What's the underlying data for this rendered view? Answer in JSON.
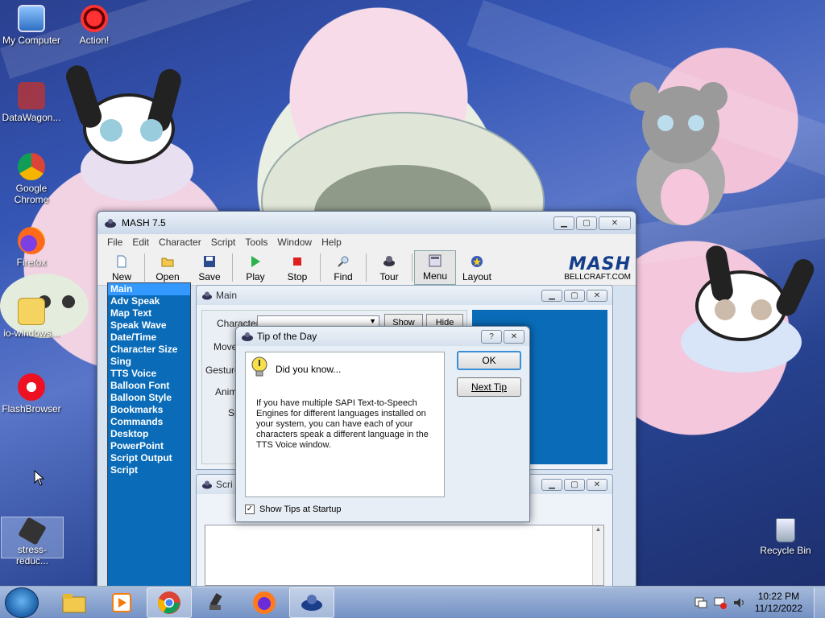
{
  "desktop": {
    "icons": [
      {
        "label": "My Computer"
      },
      {
        "label": "Action!"
      },
      {
        "label": "DataWagon..."
      },
      {
        "label": "Google Chrome"
      },
      {
        "label": "Firefox"
      },
      {
        "label": "io-windows..."
      },
      {
        "label": "FlashBrowser"
      },
      {
        "label": "stress-reduc..."
      },
      {
        "label": "Recycle Bin"
      }
    ]
  },
  "main_window": {
    "title": "MASH 7.5",
    "menu": [
      "File",
      "Edit",
      "Character",
      "Script",
      "Tools",
      "Window",
      "Help"
    ],
    "toolbar": [
      "New",
      "Open",
      "Save",
      "Play",
      "Stop",
      "Find",
      "Tour",
      "Menu",
      "Layout"
    ],
    "logo": {
      "brand": "MASH",
      "site": "BELLCRAFT.COM"
    },
    "sidenav": [
      "Main",
      "Adv Speak",
      "Map Text",
      "Speak Wave",
      "Date/Time",
      "Character Size",
      "Sing",
      "TTS Voice",
      "Balloon Font",
      "Balloon Style",
      "Bookmarks",
      "Commands",
      "Desktop",
      "PowerPoint",
      "Script Output",
      "Script"
    ],
    "child_main": {
      "title": "Main",
      "labels": [
        "Character",
        "Move",
        "Gesture",
        "Anim",
        "Sp"
      ],
      "buttons": [
        "Show",
        "Hide"
      ]
    },
    "child_script": {
      "title": "Scri"
    }
  },
  "dialog": {
    "title": "Tip of the Day",
    "heading": "Did you know...",
    "tip": "If you have multiple SAPI Text-to-Speech Engines for different languages installed on your system, you can have each of your characters speak a different language in the TTS Voice window.",
    "ok_label": "OK",
    "next_label": "Next Tip",
    "checkbox_label": "Show Tips at Startup",
    "checkbox_checked": true
  },
  "taskbar": {
    "time": "10:22 PM",
    "date": "11/12/2022"
  }
}
